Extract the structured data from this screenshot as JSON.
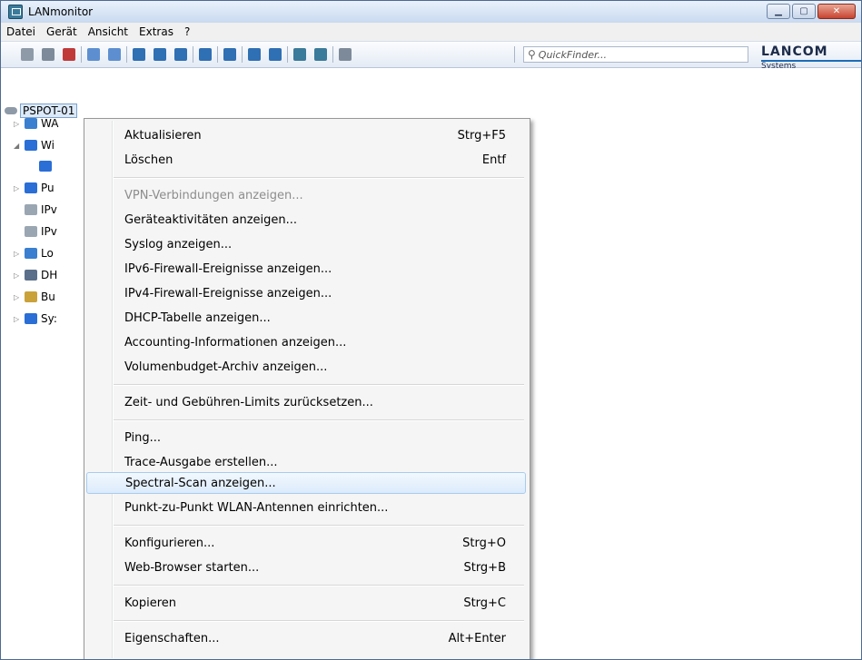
{
  "window": {
    "title": "LANmonitor",
    "buttons": [
      "minimize",
      "maximize",
      "close"
    ]
  },
  "menubar": {
    "items": [
      "Datei",
      "Gerät",
      "Ansicht",
      "Extras",
      "?"
    ]
  },
  "toolbar": {
    "quickfinder_placeholder": "QuickFinder...",
    "logo_text": "LANCOM",
    "logo_subtext": "Systems"
  },
  "tree": {
    "root_label": "PSPOT-01",
    "items": [
      {
        "label": "WA",
        "icon": "network-icon",
        "color": "#3a7fd0"
      },
      {
        "label": "Wi",
        "icon": "wifi-icon",
        "color": "#2a6ed6"
      },
      {
        "label": "",
        "icon": "wifi-small-icon",
        "color": "#2a6ed6"
      },
      {
        "label": "Pu",
        "icon": "wireless-public-icon",
        "color": "#2a6ed6"
      },
      {
        "label": "IPv",
        "icon": "firewall-icon",
        "color": "#9aa6b2"
      },
      {
        "label": "IPv",
        "icon": "firewall-icon",
        "color": "#9aa6b2"
      },
      {
        "label": "Lo",
        "icon": "network-icon",
        "color": "#3a7fd0"
      },
      {
        "label": "DH",
        "icon": "dhcp-server-icon",
        "color": "#5b6f8a"
      },
      {
        "label": "Bu",
        "icon": "budget-icon",
        "color": "#caa23a"
      },
      {
        "label": "Sy:",
        "icon": "info-icon",
        "color": "#2a6ed6"
      }
    ]
  },
  "context_menu": {
    "items": [
      {
        "label": "Aktualisieren",
        "shortcut": "Strg+F5"
      },
      {
        "label": "Löschen",
        "shortcut": "Entf"
      },
      {
        "label": "VPN-Verbindungen anzeigen...",
        "shortcut": "",
        "disabled": true
      },
      {
        "label": "Geräteaktivitäten anzeigen...",
        "shortcut": ""
      },
      {
        "label": "Syslog anzeigen...",
        "shortcut": ""
      },
      {
        "label": "IPv6-Firewall-Ereignisse anzeigen...",
        "shortcut": ""
      },
      {
        "label": "IPv4-Firewall-Ereignisse anzeigen...",
        "shortcut": ""
      },
      {
        "label": "DHCP-Tabelle anzeigen...",
        "shortcut": ""
      },
      {
        "label": "Accounting-Informationen anzeigen...",
        "shortcut": ""
      },
      {
        "label": "Volumenbudget-Archiv anzeigen...",
        "shortcut": ""
      },
      {
        "label": "Zeit- und Gebühren-Limits zurücksetzen...",
        "shortcut": ""
      },
      {
        "label": "Ping...",
        "shortcut": ""
      },
      {
        "label": "Trace-Ausgabe erstellen...",
        "shortcut": ""
      },
      {
        "label": "Spectral-Scan anzeigen...",
        "shortcut": "",
        "highlighted": true
      },
      {
        "label": "Punkt-zu-Punkt WLAN-Antennen einrichten...",
        "shortcut": ""
      },
      {
        "label": "Konfigurieren...",
        "shortcut": "Strg+O"
      },
      {
        "label": "Web-Browser starten...",
        "shortcut": "Strg+B"
      },
      {
        "label": "Kopieren",
        "shortcut": "Strg+C"
      },
      {
        "label": "Eigenschaften...",
        "shortcut": "Alt+Enter"
      }
    ]
  }
}
